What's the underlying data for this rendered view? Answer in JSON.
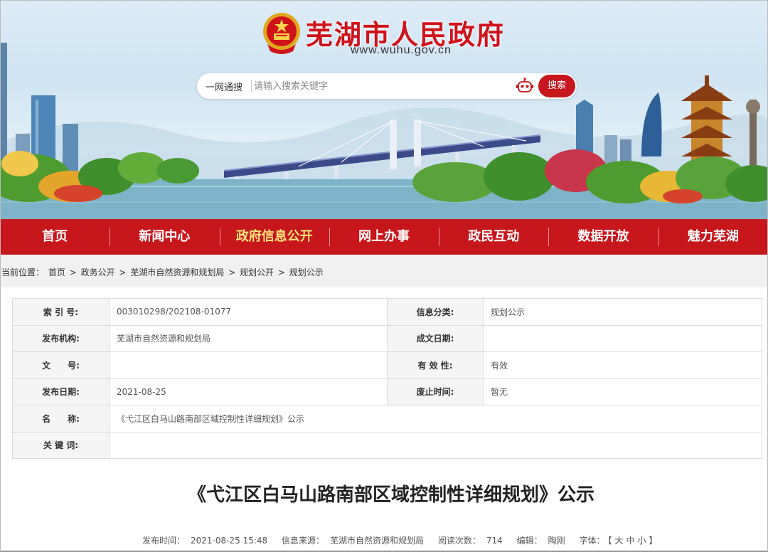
{
  "header": {
    "site_title": "芜湖市人民政府",
    "site_url": "www.wuhu.gov.cn",
    "search": {
      "scope_label": "一网通搜",
      "placeholder": "请输入搜索关键字",
      "button_label": "搜索"
    }
  },
  "nav": {
    "items": [
      {
        "label": "首页"
      },
      {
        "label": "新闻中心"
      },
      {
        "label": "政府信息公开"
      },
      {
        "label": "网上办事"
      },
      {
        "label": "政民互动"
      },
      {
        "label": "数据开放"
      },
      {
        "label": "魅力芜湖"
      }
    ],
    "active_index": 2
  },
  "breadcrumb": {
    "prefix": "当前位置：",
    "items": [
      "首页",
      "政务公开",
      "芜湖市自然资源和规划局",
      "规划公开",
      "规划公示"
    ],
    "separator": ">"
  },
  "info": {
    "index_label": "索 引 号:",
    "index_value": "003010298/202108-01077",
    "category_label": "信息分类:",
    "category_value": "规划公示",
    "publisher_label": "发布机构:",
    "publisher_value": "芜湖市自然资源和规划局",
    "created_label": "成文日期:",
    "created_value": "",
    "docno_label": "文　　号:",
    "docno_value": "",
    "validity_label": "有 效 性:",
    "validity_value": "有效",
    "pubdate_label": "发布日期:",
    "pubdate_value": "2021-08-25",
    "expire_label": "废止时间:",
    "expire_value": "暂无",
    "name_label": "名　　称:",
    "name_value": "《弋江区白马山路南部区域控制性详细规划》公示",
    "keywords_label": "关 键 词:",
    "keywords_value": ""
  },
  "article": {
    "title": "《弋江区白马山路南部区域控制性详细规划》公示",
    "meta": {
      "time_label": "发布时间：",
      "time_value": "2021-08-25 15:48",
      "source_label": "信息来源：",
      "source_value": "芜湖市自然资源和规划局",
      "reads_label": "阅读次数：",
      "reads_value": "714",
      "editor_label": "编辑：",
      "editor_value": "陶刚",
      "font_label": "字体：",
      "font_open": "【",
      "font_large": "大",
      "font_medium": "中",
      "font_small": "小",
      "font_close": "】"
    }
  },
  "colors": {
    "brand_red": "#c8161d",
    "nav_active": "#fde37a",
    "title_red": "#d0121b"
  },
  "icons": [
    "national-emblem-icon",
    "robot-icon"
  ]
}
